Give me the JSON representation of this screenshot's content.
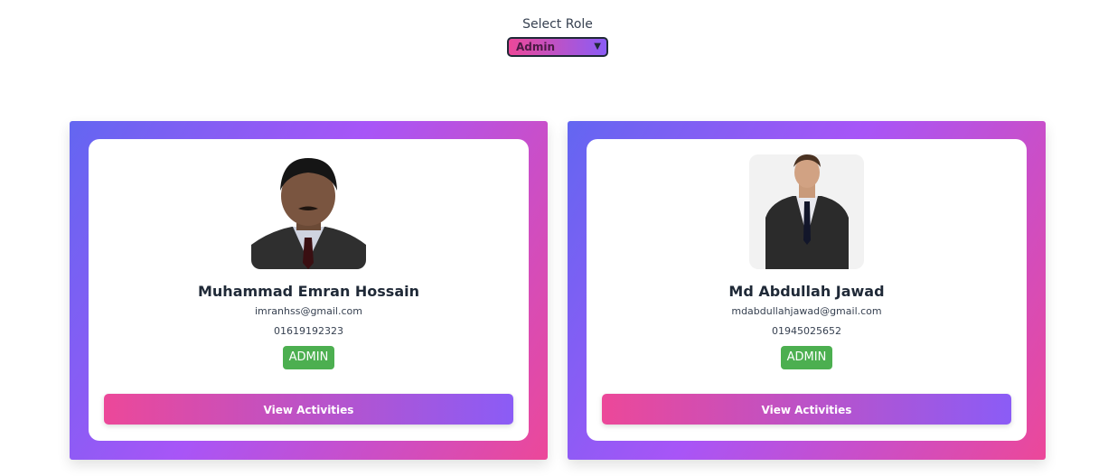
{
  "role_selector": {
    "label": "Select Role",
    "selected": "Admin"
  },
  "users": [
    {
      "name": "Muhammad Emran Hossain",
      "email": "imranhss@gmail.com",
      "phone": "01619192323",
      "role_badge": "ADMIN",
      "button_label": "View Activities"
    },
    {
      "name": "Md Abdullah Jawad",
      "email": "mdabdullahjawad@gmail.com",
      "phone": "01945025652",
      "role_badge": "ADMIN",
      "button_label": "View Activities"
    }
  ],
  "colors": {
    "gradient_start": "#ec4899",
    "gradient_end": "#8b5cf6",
    "badge": "#4caf50"
  }
}
